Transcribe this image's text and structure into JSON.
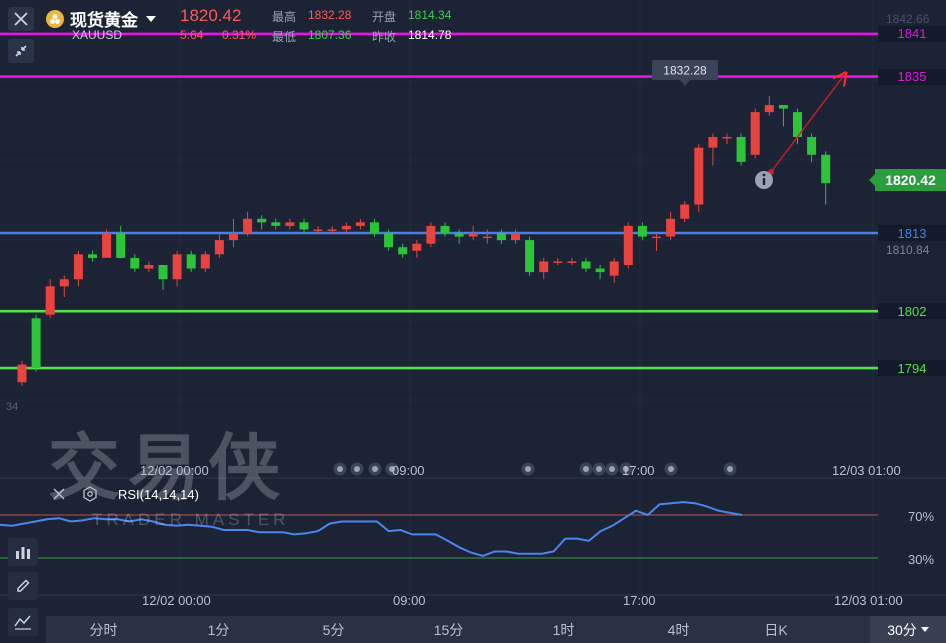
{
  "header": {
    "name": "现货黄金",
    "symbol": "XAUUSD",
    "last_price": "1820.42",
    "change": "5.64",
    "change_pct": "0.31%",
    "high_label": "最高",
    "high_value": "1832.28",
    "open_label": "开盘",
    "open_value": "1814.34",
    "low_label": "最低",
    "low_value": "1807.36",
    "prev_close_label": "昨收",
    "prev_close_value": "1814.78"
  },
  "price_axis": {
    "top_faded": "1842.66",
    "faded": "1810.84",
    "faded_left": "34",
    "current_price": "1820.42"
  },
  "levels": [
    {
      "label": "1841",
      "price": 1841,
      "color": "#e515e3"
    },
    {
      "label": "1835",
      "price": 1835,
      "color": "#e515e3"
    },
    {
      "label": "1813",
      "price": 1813,
      "color": "#4a7fe8"
    },
    {
      "label": "1802",
      "price": 1802,
      "color": "#56e04a"
    },
    {
      "label": "1794",
      "price": 1794,
      "color": "#56e04a"
    }
  ],
  "annotations": {
    "high_tooltip": "1832.28",
    "info_icon": "info-icon"
  },
  "time_axis": {
    "main": [
      "12/02 00:00",
      "09:00",
      "17:00",
      "12/03 01:00"
    ],
    "bottom": [
      "12/02 00:00",
      "09:00",
      "17:00",
      "12/03 01:00"
    ]
  },
  "rsi": {
    "label": "RSI(14,14,14)",
    "upper": "70%",
    "lower": "30%",
    "upper_color": "#c05050",
    "lower_color": "#3e9e42",
    "line_color": "#4b86ee",
    "values": [
      61,
      60,
      62,
      64,
      66,
      67,
      64,
      65,
      67,
      66,
      66,
      64,
      66,
      64,
      61,
      60,
      61,
      60,
      59,
      56,
      56,
      56,
      54,
      54,
      54,
      52,
      53,
      55,
      62,
      64,
      64,
      64,
      64,
      55,
      56,
      52,
      52,
      52,
      46,
      40,
      35,
      32,
      36,
      36,
      34,
      34,
      34,
      36,
      48,
      48,
      46,
      55,
      60,
      67,
      74,
      70,
      80,
      81,
      82,
      81,
      78,
      74,
      72,
      70
    ]
  },
  "watermark": {
    "cn": "交易侠",
    "en": "TRADER MASTER"
  },
  "timeframes": [
    "分时",
    "1分",
    "5分",
    "15分",
    "1时",
    "4时",
    "日K"
  ],
  "timeframe_selected": "30分",
  "chart_data": {
    "type": "candlestick",
    "symbol": "XAUUSD",
    "candles": [
      [
        1792.0,
        1794.5,
        1791.5,
        1795.0
      ],
      [
        1801.0,
        1794.0,
        1793.5,
        1801.5
      ],
      [
        1801.5,
        1805.5,
        1801.0,
        1806.5
      ],
      [
        1805.5,
        1806.5,
        1804.0,
        1807.0
      ],
      [
        1806.5,
        1810.0,
        1805.5,
        1810.5
      ],
      [
        1810.0,
        1809.5,
        1809.0,
        1810.5
      ],
      [
        1809.5,
        1813.0,
        1809.5,
        1813.5
      ],
      [
        1813.0,
        1809.5,
        1809.5,
        1814.0
      ],
      [
        1809.5,
        1808.0,
        1807.5,
        1810.0
      ],
      [
        1808.0,
        1808.5,
        1807.5,
        1809.0
      ],
      [
        1808.5,
        1806.5,
        1805.0,
        1807.0
      ],
      [
        1806.5,
        1810.0,
        1805.5,
        1810.5
      ],
      [
        1810.0,
        1808.0,
        1807.5,
        1810.5
      ],
      [
        1808.0,
        1810.0,
        1807.5,
        1810.5
      ],
      [
        1810.0,
        1812.0,
        1809.5,
        1813.0
      ],
      [
        1812.0,
        1813.0,
        1811.0,
        1815.0
      ],
      [
        1813.0,
        1815.0,
        1812.5,
        1816.0
      ],
      [
        1815.0,
        1814.5,
        1813.5,
        1815.5
      ],
      [
        1814.5,
        1814.0,
        1813.5,
        1815.0
      ],
      [
        1814.0,
        1814.5,
        1813.5,
        1815.0
      ],
      [
        1814.5,
        1813.5,
        1813.0,
        1815.0
      ],
      [
        1813.5,
        1813.5,
        1813.0,
        1814.0
      ],
      [
        1813.5,
        1813.5,
        1813.0,
        1814.0
      ],
      [
        1813.5,
        1814.0,
        1813.0,
        1814.5
      ],
      [
        1814.0,
        1814.5,
        1813.5,
        1815.0
      ],
      [
        1814.5,
        1813.0,
        1812.5,
        1815.0
      ],
      [
        1813.0,
        1811.0,
        1810.5,
        1813.5
      ],
      [
        1811.0,
        1810.0,
        1809.5,
        1811.5
      ],
      [
        1810.5,
        1811.5,
        1809.5,
        1812.0
      ],
      [
        1811.5,
        1814.0,
        1811.0,
        1814.5
      ],
      [
        1814.0,
        1813.0,
        1812.5,
        1814.5
      ],
      [
        1813.0,
        1812.5,
        1811.5,
        1813.5
      ],
      [
        1812.5,
        1813.0,
        1812.0,
        1814.0
      ],
      [
        1812.5,
        1812.5,
        1811.5,
        1813.5
      ],
      [
        1813.0,
        1812.0,
        1811.5,
        1813.5
      ],
      [
        1812.0,
        1813.0,
        1811.5,
        1813.5
      ],
      [
        1812.0,
        1807.5,
        1807.0,
        1812.5
      ],
      [
        1807.5,
        1809.0,
        1806.5,
        1809.5
      ],
      [
        1809.0,
        1809.0,
        1808.5,
        1809.5
      ],
      [
        1809.0,
        1809.0,
        1808.5,
        1809.5
      ],
      [
        1809.0,
        1808.0,
        1807.5,
        1809.5
      ],
      [
        1808.0,
        1807.5,
        1806.5,
        1808.5
      ],
      [
        1807.0,
        1809.0,
        1806.0,
        1809.5
      ],
      [
        1808.5,
        1814.0,
        1808.0,
        1814.5
      ],
      [
        1814.0,
        1812.5,
        1812.0,
        1814.5
      ],
      [
        1812.5,
        1812.5,
        1810.5,
        1813.0
      ],
      [
        1812.5,
        1815.0,
        1812.0,
        1816.0
      ],
      [
        1815.0,
        1817.0,
        1814.5,
        1817.5
      ],
      [
        1817.0,
        1825.0,
        1816.0,
        1825.5
      ],
      [
        1825.0,
        1826.5,
        1822.5,
        1827.0
      ],
      [
        1826.5,
        1826.5,
        1825.5,
        1827.0
      ],
      [
        1826.5,
        1823.0,
        1822.5,
        1827.0
      ],
      [
        1824.0,
        1830.0,
        1823.5,
        1830.5
      ],
      [
        1830.0,
        1831.0,
        1829.5,
        1832.28
      ],
      [
        1831.0,
        1830.5,
        1828.0,
        1831.0
      ],
      [
        1830.0,
        1826.5,
        1825.5,
        1830.5
      ],
      [
        1826.5,
        1824.0,
        1823.0,
        1827.0
      ],
      [
        1824.0,
        1820.0,
        1817.0,
        1824.5
      ]
    ],
    "annotation_high": 1832.28,
    "last": 1820.42
  }
}
